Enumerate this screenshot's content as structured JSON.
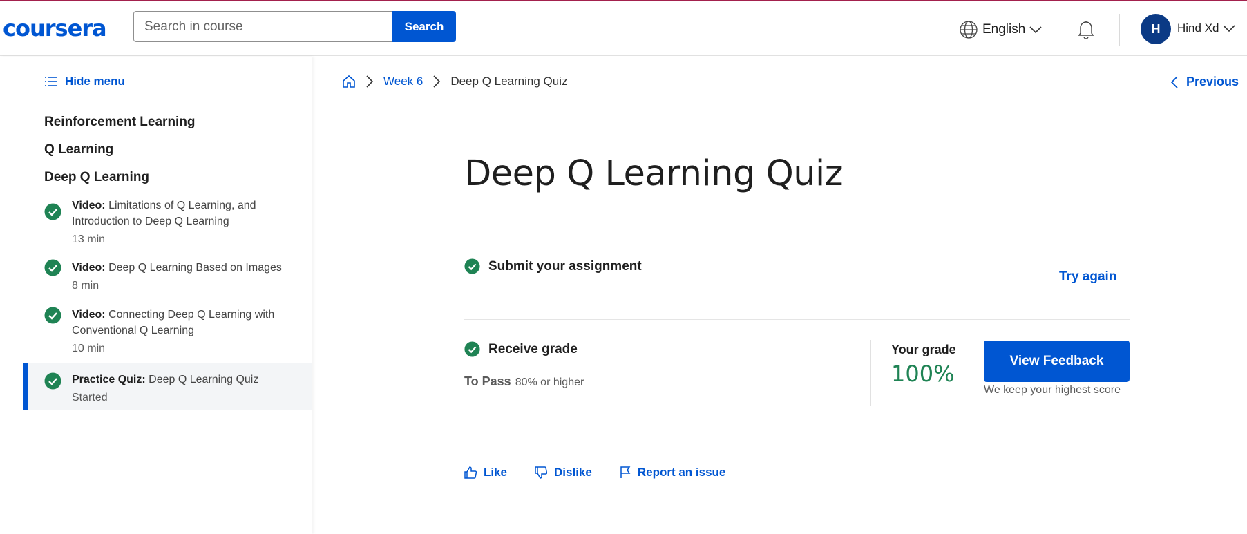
{
  "header": {
    "logo": "coursera",
    "search_placeholder": "Search in course",
    "search_button": "Search",
    "language": "English",
    "avatar_initial": "H",
    "user_name": "Hind Xd"
  },
  "sidebar": {
    "hide_menu": "Hide menu",
    "modules": [
      "Reinforcement Learning",
      "Q Learning",
      "Deep Q Learning"
    ],
    "items": [
      {
        "type": "Video:",
        "title": "Limitations of Q Learning, and Introduction to Deep Q Learning",
        "meta": "13 min"
      },
      {
        "type": "Video:",
        "title": "Deep Q Learning Based on Images",
        "meta": "8 min"
      },
      {
        "type": "Video:",
        "title": "Connecting Deep Q Learning with Conventional Q Learning",
        "meta": "10 min"
      },
      {
        "type": "Practice Quiz:",
        "title": "Deep Q Learning Quiz",
        "meta": "Started"
      }
    ]
  },
  "breadcrumb": {
    "week": "Week 6",
    "current": "Deep Q Learning Quiz"
  },
  "nav": {
    "previous": "Previous"
  },
  "main": {
    "title": "Deep Q Learning Quiz",
    "submit_label": "Submit your assignment",
    "try_again": "Try again",
    "receive_label": "Receive grade",
    "to_pass_label": "To Pass",
    "to_pass_value": "80% or higher",
    "your_grade_label": "Your grade",
    "grade_value": "100%",
    "view_feedback": "View Feedback",
    "keep_note": "We keep your highest score"
  },
  "actions": {
    "like": "Like",
    "dislike": "Dislike",
    "report": "Report an issue"
  },
  "colors": {
    "accent": "#0056d2",
    "success": "#1f8354",
    "topline": "#a3214d"
  }
}
